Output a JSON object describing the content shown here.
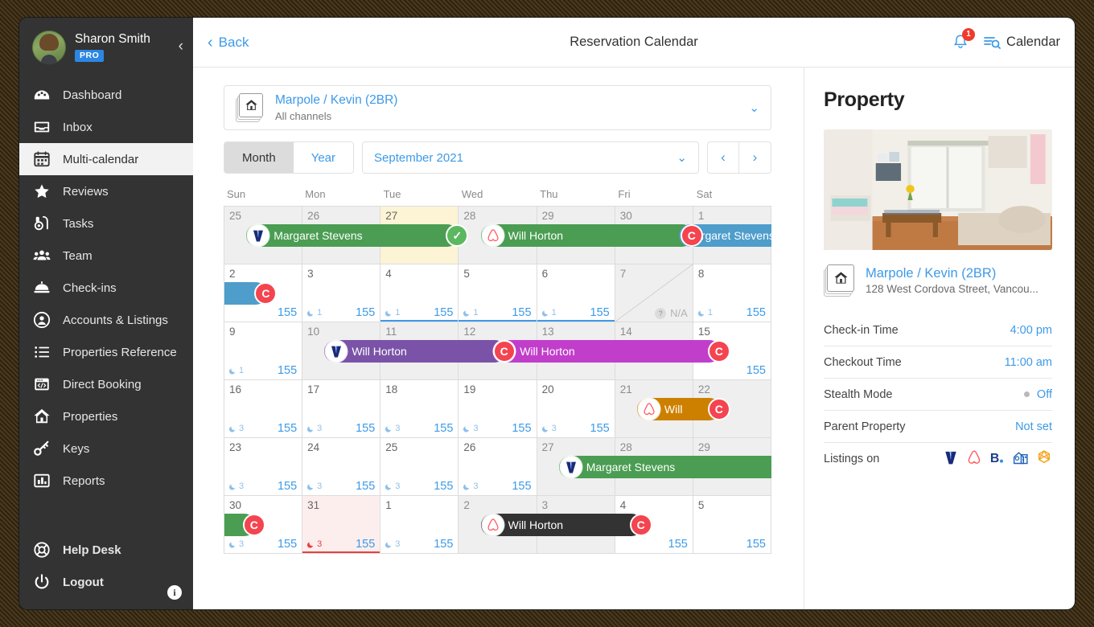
{
  "sidebar": {
    "user": {
      "name": "Sharon Smith",
      "badge": "PRO"
    },
    "collapse_icon": "chevron-left-icon",
    "items": [
      {
        "label": "Dashboard",
        "icon": "dashboard-icon"
      },
      {
        "label": "Inbox",
        "icon": "inbox-icon"
      },
      {
        "label": "Multi-calendar",
        "icon": "calendar-icon",
        "active": true
      },
      {
        "label": "Reviews",
        "icon": "star-icon"
      },
      {
        "label": "Tasks",
        "icon": "vacuum-icon"
      },
      {
        "label": "Team",
        "icon": "people-icon"
      },
      {
        "label": "Check-ins",
        "icon": "bell-desk-icon"
      },
      {
        "label": "Accounts & Listings",
        "icon": "user-circle-icon"
      },
      {
        "label": "Properties Reference",
        "icon": "list-icon"
      },
      {
        "label": "Direct Booking",
        "icon": "code-window-icon"
      },
      {
        "label": "Properties",
        "icon": "home-icon"
      },
      {
        "label": "Keys",
        "icon": "key-icon"
      },
      {
        "label": "Reports",
        "icon": "bar-chart-icon"
      }
    ],
    "bottom_items": [
      {
        "label": "Help Desk",
        "icon": "lifebuoy-icon"
      },
      {
        "label": "Logout",
        "icon": "power-icon"
      }
    ],
    "info_label": "i"
  },
  "topbar": {
    "back_label": "Back",
    "title": "Reservation Calendar",
    "notification_count": "1",
    "calendar_label": "Calendar"
  },
  "selector": {
    "property": "Marpole / Kevin (2BR)",
    "channels": "All channels",
    "chevron": "chevron-down-icon"
  },
  "toolbar": {
    "month_label": "Month",
    "year_label": "Year",
    "period": "September 2021",
    "prev": "‹",
    "next": "›"
  },
  "calendar": {
    "dow": [
      "Sun",
      "Mon",
      "Tue",
      "Wed",
      "Thu",
      "Fri",
      "Sat"
    ],
    "days": [
      {
        "n": "25",
        "dim": true
      },
      {
        "n": "26",
        "dim": true
      },
      {
        "n": "27",
        "today": true
      },
      {
        "n": "28",
        "dim": true
      },
      {
        "n": "29",
        "dim": true
      },
      {
        "n": "30",
        "dim": true
      },
      {
        "n": "1",
        "dim": true
      },
      {
        "n": "2",
        "price": "155"
      },
      {
        "n": "3",
        "nights": "1",
        "price": "155"
      },
      {
        "n": "4",
        "nights": "1",
        "price": "155",
        "sel": true
      },
      {
        "n": "5",
        "nights": "1",
        "price": "155",
        "sel": true
      },
      {
        "n": "6",
        "nights": "1",
        "price": "155",
        "sel": true
      },
      {
        "n": "7",
        "dim": true,
        "na": "N/A"
      },
      {
        "n": "8",
        "nights": "1",
        "price": "155"
      },
      {
        "n": "9",
        "nights": "1",
        "price": "155"
      },
      {
        "n": "10",
        "dim": true
      },
      {
        "n": "11",
        "dim": true
      },
      {
        "n": "12",
        "dim": true
      },
      {
        "n": "13",
        "dim": true
      },
      {
        "n": "14",
        "dim": true
      },
      {
        "n": "15",
        "price": "155"
      },
      {
        "n": "16",
        "nights": "3",
        "price": "155"
      },
      {
        "n": "17",
        "nights": "3",
        "price": "155"
      },
      {
        "n": "18",
        "nights": "3",
        "price": "155"
      },
      {
        "n": "19",
        "nights": "3",
        "price": "155"
      },
      {
        "n": "20",
        "nights": "3",
        "price": "155"
      },
      {
        "n": "21",
        "dim": true
      },
      {
        "n": "22",
        "dim": true
      },
      {
        "n": "23",
        "nights": "3",
        "price": "155"
      },
      {
        "n": "24",
        "nights": "3",
        "price": "155"
      },
      {
        "n": "25",
        "nights": "3",
        "price": "155"
      },
      {
        "n": "26",
        "nights": "3",
        "price": "155"
      },
      {
        "n": "27",
        "dim": true
      },
      {
        "n": "28",
        "dim": true
      },
      {
        "n": "29",
        "dim": true
      },
      {
        "n": "30",
        "nights": "3",
        "price": "155"
      },
      {
        "n": "31",
        "nights": "3",
        "price": "155",
        "red": true
      },
      {
        "n": "1",
        "nights": "3",
        "price": "155"
      },
      {
        "n": "2",
        "dim": true
      },
      {
        "n": "3",
        "dim": true
      },
      {
        "n": "4",
        "price": "155"
      },
      {
        "n": "5",
        "price": "155"
      }
    ],
    "bookings": [
      {
        "guest": "Margaret Stevens",
        "channel": "vrbo-icon",
        "color": "#4a9d52",
        "row": 0,
        "start": 0.28,
        "end": 3.0,
        "shape": "rb",
        "endcap": "check",
        "endcap_label": "✓"
      },
      {
        "guest": "Will Horton",
        "channel": "airbnb-icon",
        "color": "#4a9d52",
        "row": 0,
        "start": 3.28,
        "end": 6.0,
        "shape": "rb",
        "endcap": "c",
        "endcap_label": "C"
      },
      {
        "guest": "Margaret Stevens",
        "channel": "none",
        "color": "#4e9dcb",
        "row": 0,
        "start": 5.82,
        "end": 7.0,
        "shape": "rl",
        "endcap": "none",
        "endcap_label": ""
      },
      {
        "guest": "",
        "channel": "none",
        "color": "#4e9dcb",
        "row": 1,
        "start": 0.0,
        "end": 0.55,
        "shape": "rr",
        "endcap": "c",
        "endcap_label": "C"
      },
      {
        "guest": "Will Horton",
        "channel": "vrbo-icon",
        "color": "#7a53a8",
        "row": 2,
        "start": 1.28,
        "end": 3.6,
        "shape": "rb",
        "endcap": "c",
        "endcap_label": "C"
      },
      {
        "guest": "Will Horton",
        "channel": "vrbo-icon",
        "color": "#c13ecb",
        "row": 2,
        "start": 3.43,
        "end": 6.35,
        "shape": "rb",
        "endcap": "c",
        "endcap_label": "C"
      },
      {
        "guest": "Will",
        "channel": "airbnb-icon",
        "color": "#cd8000",
        "row": 3,
        "start": 5.28,
        "end": 6.35,
        "shape": "rb",
        "endcap": "c",
        "endcap_label": "C"
      },
      {
        "guest": "Margaret Stevens",
        "channel": "vrbo-icon",
        "color": "#4a9d52",
        "row": 4,
        "start": 4.28,
        "end": 7.0,
        "shape": "rl",
        "endcap": "none",
        "endcap_label": ""
      },
      {
        "guest": "",
        "channel": "none",
        "color": "#4a9d52",
        "row": 5,
        "start": 0.0,
        "end": 0.4,
        "shape": "rr",
        "endcap": "c",
        "endcap_label": "C"
      },
      {
        "guest": "Will Horton",
        "channel": "airbnb-icon",
        "color": "#333333",
        "row": 5,
        "start": 3.28,
        "end": 5.35,
        "shape": "rb",
        "endcap": "c",
        "endcap_label": "C"
      }
    ]
  },
  "property": {
    "heading": "Property",
    "name": "Marpole / Kevin (2BR)",
    "address": "128 West Cordova Street, Vancou...",
    "rows": [
      {
        "label": "Check-in Time",
        "value": "4:00 pm"
      },
      {
        "label": "Checkout Time",
        "value": "11:00 am"
      },
      {
        "label": "Stealth Mode",
        "value": "Off",
        "dot": true
      },
      {
        "label": "Parent Property",
        "value": "Not set"
      }
    ],
    "listings_label": "Listings on",
    "listings": [
      "vrbo-icon",
      "airbnb-icon",
      "booking-com-icon",
      "homeaway-icon",
      "expedia-icon"
    ]
  }
}
